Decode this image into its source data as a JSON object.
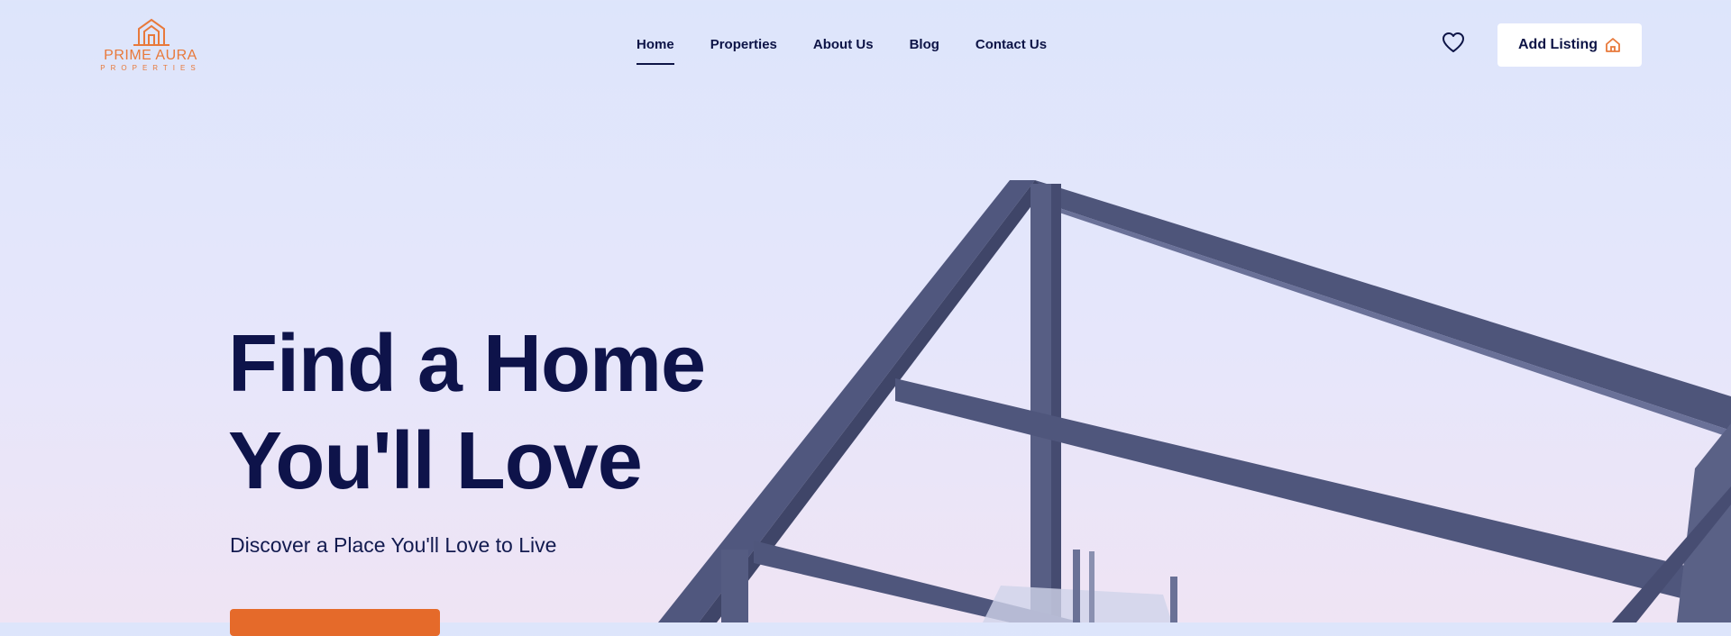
{
  "brand": {
    "name": "PRIME AURA",
    "tagline": "PROPERTIES",
    "color": "#e8793b"
  },
  "nav": {
    "items": [
      {
        "label": "Home",
        "active": true
      },
      {
        "label": "Properties"
      },
      {
        "label": "About Us"
      },
      {
        "label": "Blog"
      },
      {
        "label": "Contact Us"
      }
    ]
  },
  "header": {
    "favorites_icon": "heart-icon",
    "add_listing_label": "Add Listing",
    "add_listing_icon": "house-icon"
  },
  "hero": {
    "title_line1": "Find a Home",
    "title_line2": "You'll Love",
    "subtitle": "Discover a Place You'll Love to Live",
    "cta_color": "#e56a2a",
    "title_color": "#0e134a"
  }
}
